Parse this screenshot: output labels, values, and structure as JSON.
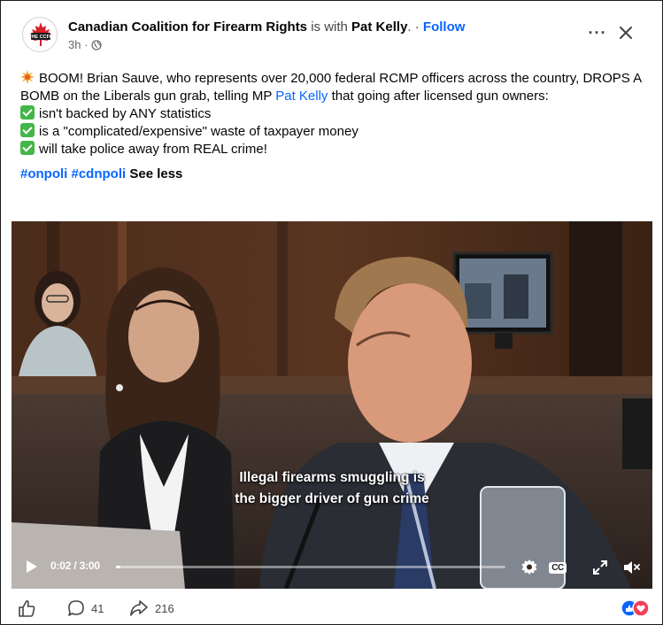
{
  "post": {
    "page_name": "Canadian Coalition for Firearm Rights",
    "with_text": " is with ",
    "tagged_name": "Pat Kelly",
    "after_tag": ". · ",
    "follow_label": "Follow",
    "time_ago": "3h ·",
    "avatar_text": "THE CCFR"
  },
  "body": {
    "intro_1": "BOOM! Brian Sauve, who represents over 20,000 federal RCMP officers across the country, DROPS A BOMB on the Liberals gun grab, telling MP ",
    "mention": "Pat Kelly",
    "intro_2": " that going after licensed gun owners:",
    "bullets": [
      "isn't backed by ANY statistics",
      "is a \"complicated/expensive\" waste of taxpayer money",
      "will take police away from REAL crime!"
    ],
    "hashtag_1": "#onpoli",
    "hashtag_2": "#cdnpoli",
    "see_less": "See less"
  },
  "video": {
    "caption_line_1": "Illegal firearms smuggling is",
    "caption_line_2": "the bigger driver of gun crime",
    "time_display": "0:02 / 3:00",
    "progress_fraction": 0.011
  },
  "footer": {
    "comments_count": "41",
    "shares_count": "216"
  },
  "colors": {
    "link": "#0866ff",
    "check_green": "#43b649",
    "like_blue": "#0866ff",
    "love_red": "#f33e58"
  }
}
